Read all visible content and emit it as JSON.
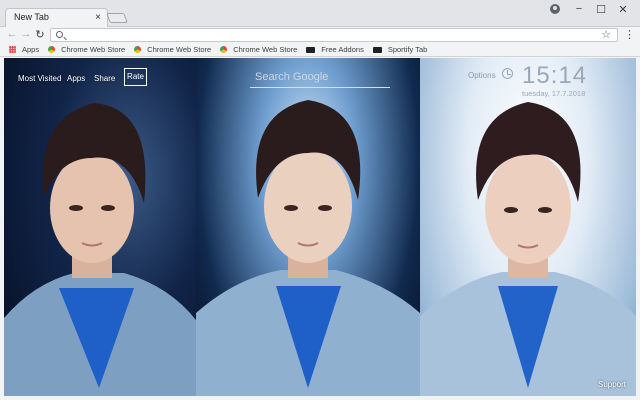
{
  "browser": {
    "tab_title": "New Tab",
    "tab_close": "×",
    "window_controls": {
      "minimize": "−",
      "maximize": "☐",
      "close": "✕"
    },
    "nav": {
      "back": "←",
      "forward": "→",
      "reload": "↻"
    },
    "address": {
      "value": "",
      "star": "☆"
    },
    "menu": "⋮"
  },
  "bookmarks": [
    {
      "label": "Apps",
      "icon": "apps-grid-icon"
    },
    {
      "label": "Chrome Web Store",
      "icon": "chrome-web-store-icon"
    },
    {
      "label": "Chrome Web Store",
      "icon": "chrome-web-store-icon"
    },
    {
      "label": "Chrome Web Store",
      "icon": "chrome-web-store-icon"
    },
    {
      "label": "Free Addons",
      "icon": "addon-icon"
    },
    {
      "label": "Sportify Tab",
      "icon": "addon-icon"
    }
  ],
  "newtab": {
    "links": {
      "most_visited": "Most Visited",
      "apps": "Apps",
      "share": "Share",
      "rate": "Rate"
    },
    "search_placeholder": "Search Google",
    "options": "Options",
    "time": "15:14",
    "date": "tuesday, 17.7.2018",
    "support": "Support"
  },
  "colors": {
    "panel_dark": "#0b1c3a",
    "panel_bright": "#eaf1f8",
    "jacket_denim": "#8fb0cf",
    "sweater_blue": "#1f5fc8",
    "hair": "#2a1b1d",
    "skin": "#e9c6b2"
  }
}
